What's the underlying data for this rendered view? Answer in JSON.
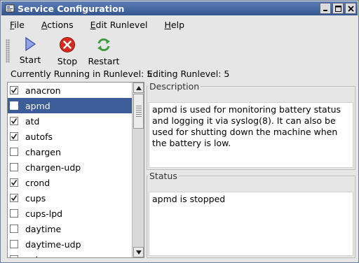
{
  "window": {
    "title": "Service Configuration"
  },
  "menubar": {
    "items": [
      {
        "label": "File"
      },
      {
        "label": "Actions"
      },
      {
        "label": "Edit Runlevel"
      },
      {
        "label": "Help"
      }
    ]
  },
  "toolbar": {
    "start_label": "Start",
    "stop_label": "Stop",
    "restart_label": "Restart"
  },
  "status": {
    "running": "Currently Running in Runlevel: 5",
    "editing": "Editing Runlevel: 5"
  },
  "services": [
    {
      "name": "anacron",
      "checked": true,
      "selected": false
    },
    {
      "name": "apmd",
      "checked": false,
      "selected": true
    },
    {
      "name": "atd",
      "checked": true,
      "selected": false
    },
    {
      "name": "autofs",
      "checked": true,
      "selected": false
    },
    {
      "name": "chargen",
      "checked": false,
      "selected": false
    },
    {
      "name": "chargen-udp",
      "checked": false,
      "selected": false
    },
    {
      "name": "crond",
      "checked": true,
      "selected": false
    },
    {
      "name": "cups",
      "checked": true,
      "selected": false
    },
    {
      "name": "cups-lpd",
      "checked": false,
      "selected": false
    },
    {
      "name": "daytime",
      "checked": false,
      "selected": false
    },
    {
      "name": "daytime-udp",
      "checked": false,
      "selected": false
    },
    {
      "name": "echo",
      "checked": false,
      "selected": false
    }
  ],
  "description": {
    "legend": "Description",
    "text": "apmd is used for monitoring battery status and logging it via syslog(8). It can also be used for shutting down the machine when the battery is low."
  },
  "service_status": {
    "legend": "Status",
    "text": "apmd is stopped"
  },
  "colors": {
    "title_bar": "#35558e",
    "selection": "#3d5d9a",
    "stop_icon": "#d42a1f",
    "restart_icon": "#3c9a3a",
    "start_icon": "#5a6fc8"
  },
  "icons": {
    "start": "play-triangle-icon",
    "stop": "stop-circle-icon",
    "restart": "refresh-arrows-icon"
  }
}
